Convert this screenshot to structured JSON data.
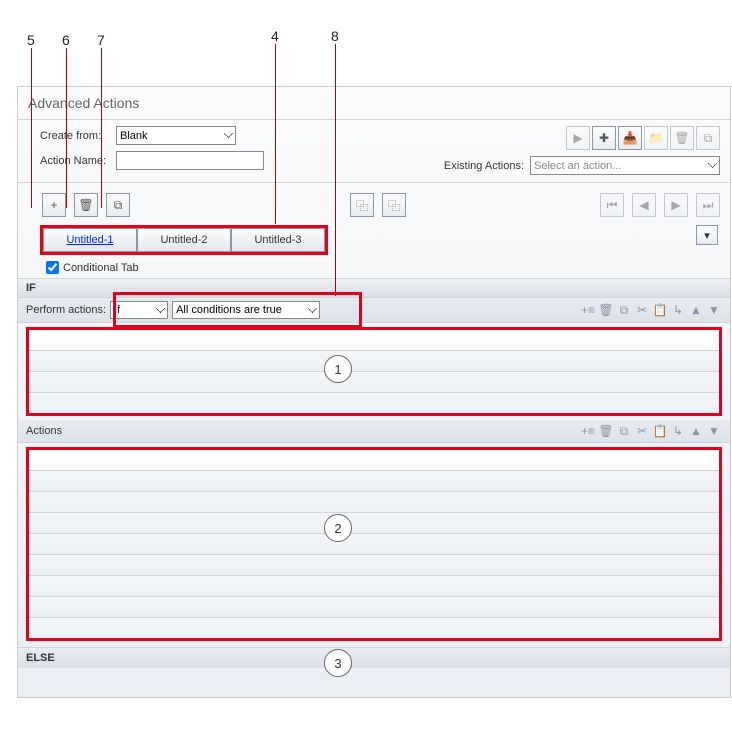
{
  "callouts": {
    "c1": "1",
    "c2": "2",
    "c3": "3",
    "c4": "4",
    "c5": "5",
    "c6": "6",
    "c7": "7",
    "c8": "8"
  },
  "dialog": {
    "title": "Advanced Actions"
  },
  "form": {
    "create_from_label": "Create from:",
    "create_from_value": "Blank",
    "action_name_label": "Action Name:",
    "action_name_value": ""
  },
  "existing": {
    "label": "Existing Actions:",
    "placeholder": "Select an action..."
  },
  "tabs": {
    "t1": "Untitled-1",
    "t2": "Untitled-2",
    "t3": "Untitled-3"
  },
  "conditional_checkbox": {
    "label": "Conditional Tab",
    "checked": true
  },
  "sections": {
    "if": "IF",
    "actions": "Actions",
    "else": "ELSE"
  },
  "perform": {
    "label": "Perform actions:",
    "if_value": "If",
    "cond_value": "All conditions are true"
  }
}
